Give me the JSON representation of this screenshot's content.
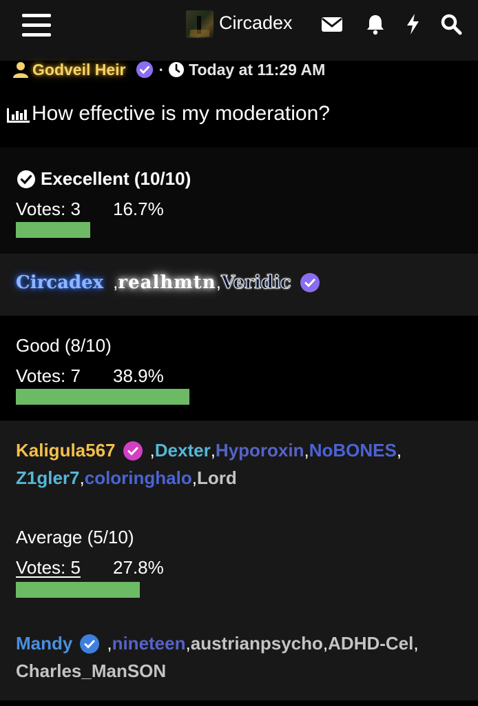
{
  "nav": {
    "site_name": "Circadex",
    "icons": [
      "hamburger-menu-icon",
      "envelope-icon",
      "bell-icon",
      "lightning-icon",
      "search-icon"
    ]
  },
  "post": {
    "author": "Godveil Heir",
    "meta_separator": "·",
    "time": "Today at 11:29 AM",
    "title": "How effective is my moderation?"
  },
  "poll": {
    "options": [
      {
        "label": "Execellent (10/10)",
        "selected": true,
        "votes_text": "Votes: 3",
        "percent_text": "16.7%",
        "votes": 3,
        "percent": 16.7,
        "voters": [
          {
            "name": "Circadex",
            "color": "#8fb6ff",
            "sep": ", "
          },
          {
            "name": "realhmtn",
            "color": "#ffffff",
            "sep": ", "
          },
          {
            "name": "Veridic",
            "color": "#ffffff",
            "sep": ""
          }
        ]
      },
      {
        "label": "Good (8/10)",
        "selected": false,
        "votes_text": "Votes: 7",
        "percent_text": "38.9%",
        "votes": 7,
        "percent": 38.9,
        "voters": [
          {
            "name": "Kaligula567",
            "color": "#f5c04a",
            "sep": ", "
          },
          {
            "name": "Dexter",
            "color": "#55b7d6",
            "sep": ", "
          },
          {
            "name": "Hyporoxin",
            "color": "#5563c7",
            "sep": ", "
          },
          {
            "name": "NoBONES",
            "color": "#4c63d4",
            "sep": ","
          },
          {
            "name": "Z1gler7",
            "color": "#55b7d6",
            "sep": ", "
          },
          {
            "name": "coloringhalo",
            "color": "#4c63d4",
            "sep": ", "
          },
          {
            "name": "Lord",
            "color": "#c4c4c4",
            "sep": ""
          }
        ]
      },
      {
        "label": "Average (5/10)",
        "selected": false,
        "votes_text": "Votes: 5",
        "percent_text": "27.8%",
        "votes": 5,
        "percent": 27.8,
        "voters": [
          {
            "name": "Mandy",
            "color": "#4a8fe0",
            "sep": ", "
          },
          {
            "name": "nineteen",
            "color": "#5563c7",
            "sep": ", "
          },
          {
            "name": "austrianpsycho",
            "color": "#c4c4c4",
            "sep": ", "
          },
          {
            "name": "ADHD-Cel",
            "color": "#c4c4c4",
            "sep": ","
          },
          {
            "name": "Charles_ManSON",
            "color": "#c4c4c4",
            "sep": ""
          }
        ]
      }
    ]
  },
  "colors": {
    "bar": "#6dba64",
    "verified_purple": "#8a6df0",
    "verified_magenta": "#d23fc2",
    "verified_blue": "#3e7fe0",
    "author_gold": "#f6d36b"
  }
}
